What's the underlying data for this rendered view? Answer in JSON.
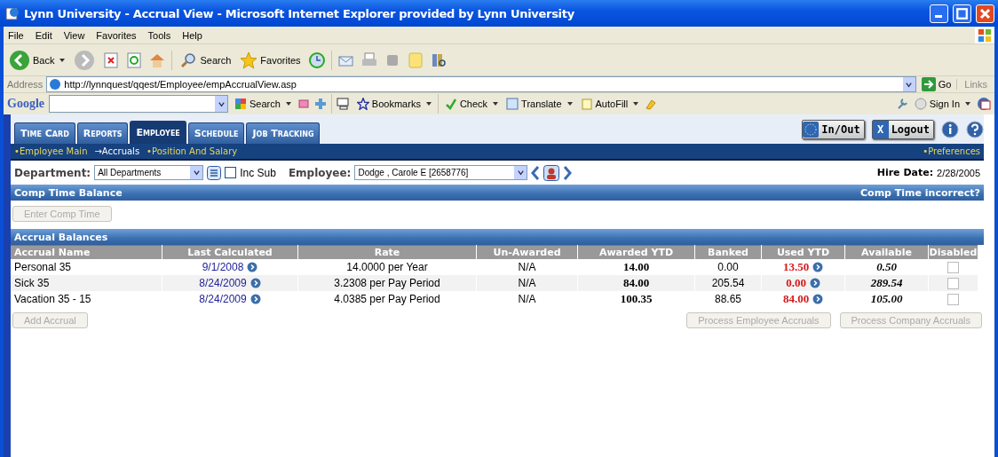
{
  "window": {
    "title": "Lynn University - Accrual View - Microsoft Internet Explorer provided by Lynn University"
  },
  "menu": [
    "File",
    "Edit",
    "View",
    "Favorites",
    "Tools",
    "Help"
  ],
  "toolbar": {
    "back": "Back",
    "search": "Search",
    "favorites": "Favorites"
  },
  "address_bar": {
    "label": "Address",
    "url": "http://lynnquest/qqest/Employee/empAccrualView.asp",
    "go": "Go",
    "links": "Links"
  },
  "google_bar": {
    "logo": "Google",
    "search": "Search",
    "bookmarks": "Bookmarks",
    "check": "Check",
    "translate": "Translate",
    "autofill": "AutoFill",
    "sign_in": "Sign In"
  },
  "tabs": [
    {
      "label": "Time Card",
      "selected": false
    },
    {
      "label": "Reports",
      "selected": false
    },
    {
      "label": "Employee",
      "selected": true
    },
    {
      "label": "Schedule",
      "selected": false
    },
    {
      "label": "Job Tracking",
      "selected": false
    }
  ],
  "header_buttons": {
    "in_out": "In/Out",
    "logout_mark": "X",
    "logout": "Logout"
  },
  "subnav": [
    {
      "label": "•Employee Main",
      "selected": false
    },
    {
      "label": "→Accruals",
      "selected": true
    },
    {
      "label": "•Position And Salary",
      "selected": false
    }
  ],
  "preferences": "•Preferences",
  "filters": {
    "department_label": "Department:",
    "department": "All Departments",
    "inc_sub": {
      "label": "Inc Sub",
      "checked": false
    },
    "employee_label": "Employee:",
    "employee": "Dodge , Carole E [2658776]",
    "hire_date_label": "Hire Date:",
    "hire_date": "2/28/2005"
  },
  "comp_time": {
    "title": "Comp Time Balance",
    "link": "Comp Time incorrect?",
    "button": {
      "label": "Enter Comp Time",
      "disabled": true
    }
  },
  "accruals": {
    "title": "Accrual Balances",
    "columns": [
      "Accrual Name",
      "Last Calculated",
      "Rate",
      "Un-Awarded",
      "Awarded YTD",
      "Banked",
      "Used YTD",
      "Available",
      "Disabled"
    ],
    "rows": [
      {
        "name": "Personal 35",
        "last_calculated": "9/1/2008",
        "rate": "14.0000 per Year",
        "un_awarded": "N/A",
        "awarded_ytd": "14.00",
        "banked": "0.00",
        "used_ytd": "13.50",
        "available": "0.50",
        "disabled": false
      },
      {
        "name": "Sick 35",
        "last_calculated": "8/24/2009",
        "rate": "3.2308 per Pay Period",
        "un_awarded": "N/A",
        "awarded_ytd": "84.00",
        "banked": "205.54",
        "used_ytd": "0.00",
        "available": "289.54",
        "disabled": false
      },
      {
        "name": "Vacation 35 - 15",
        "last_calculated": "8/24/2009",
        "rate": "4.0385 per Pay Period",
        "un_awarded": "N/A",
        "awarded_ytd": "100.35",
        "banked": "88.65",
        "used_ytd": "84.00",
        "available": "105.00",
        "disabled": false
      }
    ],
    "buttons": [
      {
        "label": "Add Accrual",
        "disabled": true
      },
      {
        "label": "Process Employee Accruals",
        "disabled": true
      },
      {
        "label": "Process Company Accruals",
        "disabled": true
      }
    ]
  }
}
